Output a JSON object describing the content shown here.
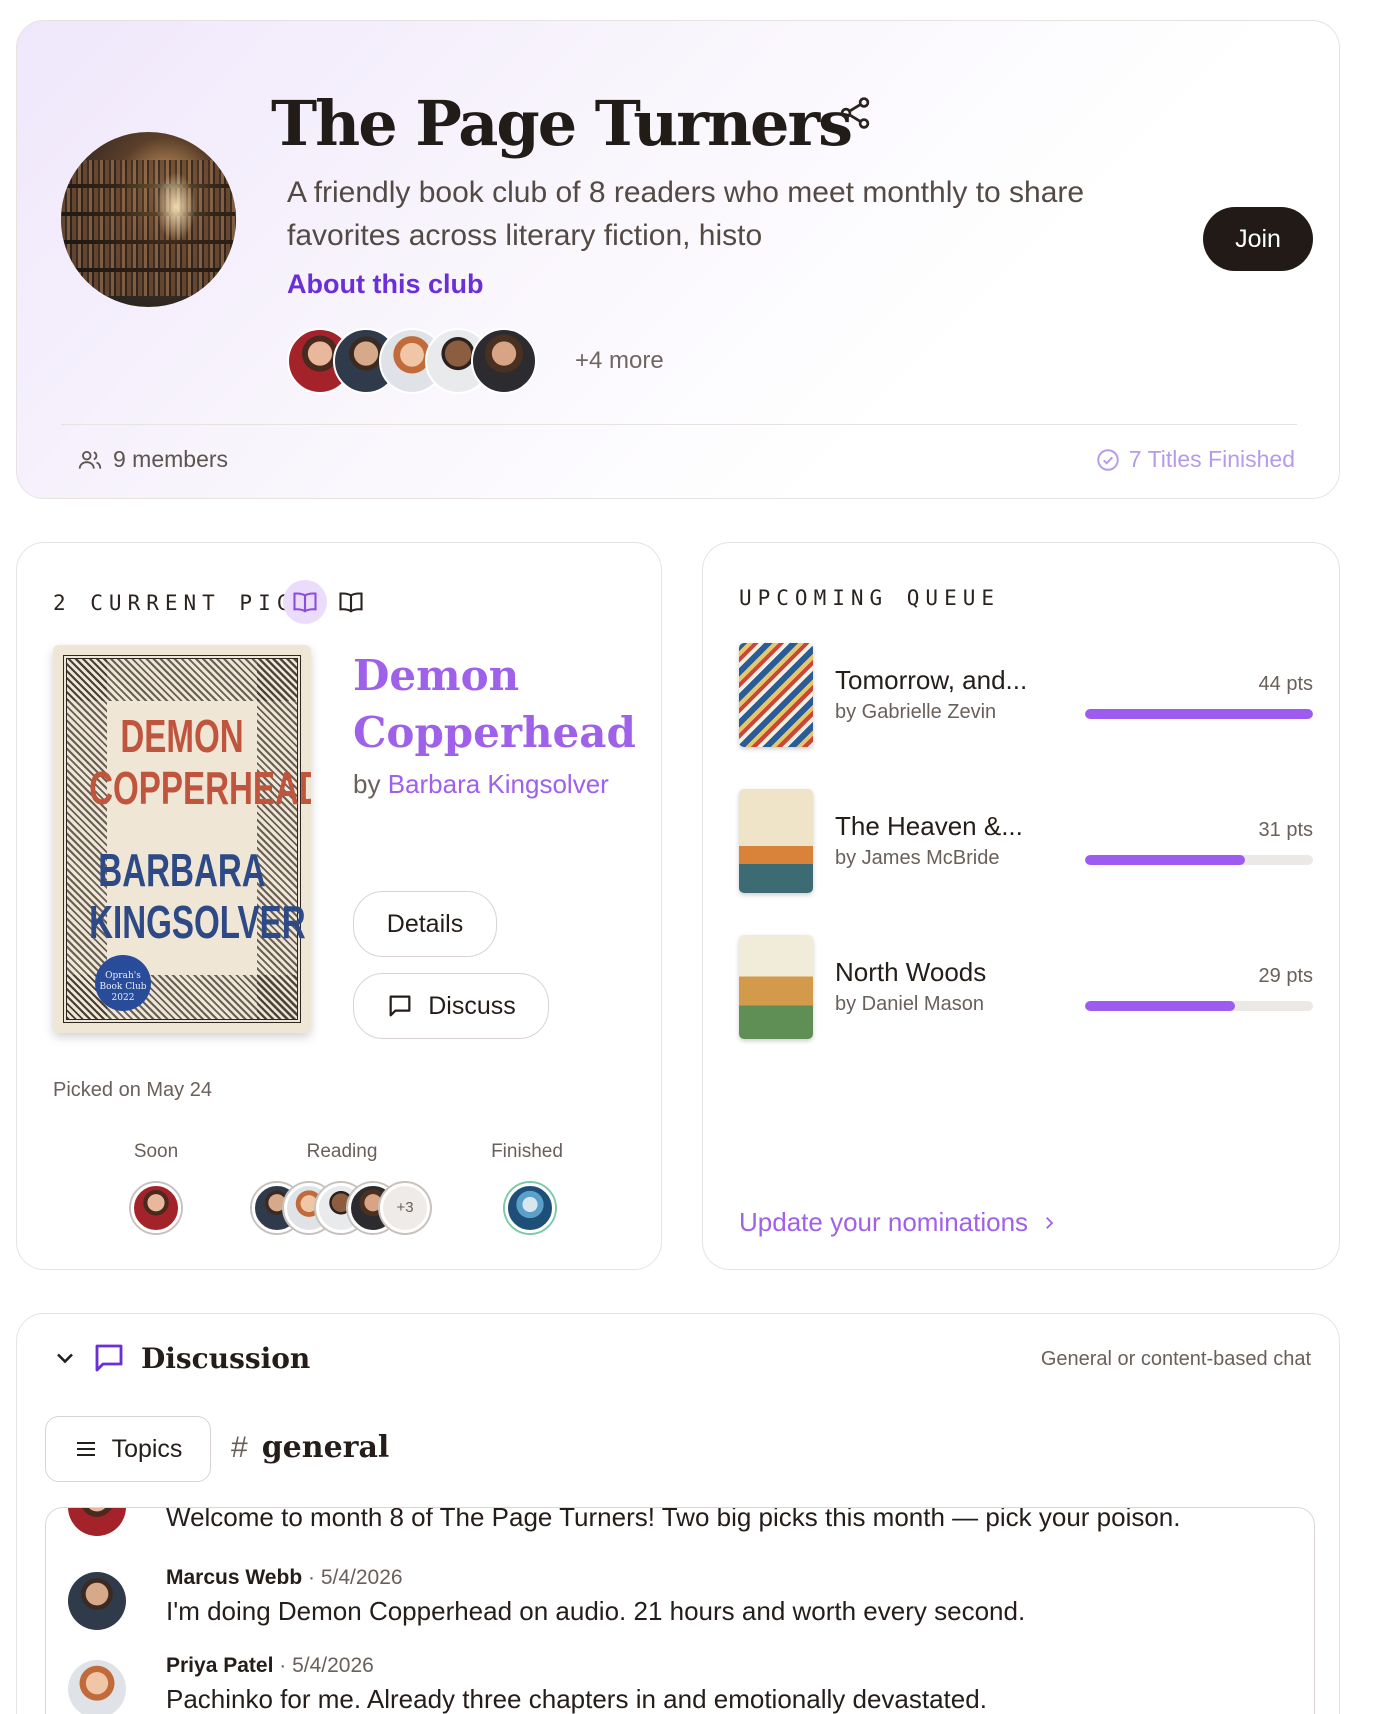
{
  "club": {
    "title": "The Page Turners",
    "description": "A friendly book club of 8 readers who meet monthly to share favorites across literary fiction, histo",
    "about_label": "About this club",
    "more_members": "+4 more",
    "join_label": "Join",
    "members_count": "9 members",
    "titles_finished": "7 Titles Finished",
    "accent": "#6a2fd6"
  },
  "current_picks": {
    "label": "2 CURRENT PICKS",
    "book": {
      "cover_lines": [
        "DEMON",
        "COPPERHEAD",
        "BARBARA",
        "KINGSOLVER"
      ],
      "cover_badge": "Oprah's Book Club 2022",
      "title": "Demon Copperhead",
      "by": "by",
      "author": "Barbara Kingsolver"
    },
    "details_label": "Details",
    "discuss_label": "Discuss",
    "picked_on": "Picked on May 24",
    "statuses": [
      "Soon",
      "Reading",
      "Finished"
    ],
    "reading_more": "+3"
  },
  "queue": {
    "label": "UPCOMING QUEUE",
    "items": [
      {
        "title": "Tomorrow, and...",
        "author": "by Gabrielle Zevin",
        "pts": "44 pts",
        "progress": 1.0
      },
      {
        "title": "The Heaven &...",
        "author": "by James McBride",
        "pts": "31 pts",
        "progress": 0.7
      },
      {
        "title": "North Woods",
        "author": "by Daniel Mason",
        "pts": "29 pts",
        "progress": 0.66
      }
    ],
    "update_label": "Update your nominations"
  },
  "discussion": {
    "title": "Discussion",
    "hint": "General or content-based chat",
    "topics_label": "Topics",
    "channel": "general",
    "messages": [
      {
        "author": "",
        "date": "",
        "text": "Welcome to month 8 of The Page Turners! Two big picks this month — pick your poison."
      },
      {
        "author": "Marcus Webb",
        "date": "· 5/4/2026",
        "text": "I'm doing Demon Copperhead on audio. 21 hours and worth every second."
      },
      {
        "author": "Priya Patel",
        "date": "· 5/4/2026",
        "text": "Pachinko for me. Already three chapters in and emotionally devastated."
      }
    ]
  }
}
